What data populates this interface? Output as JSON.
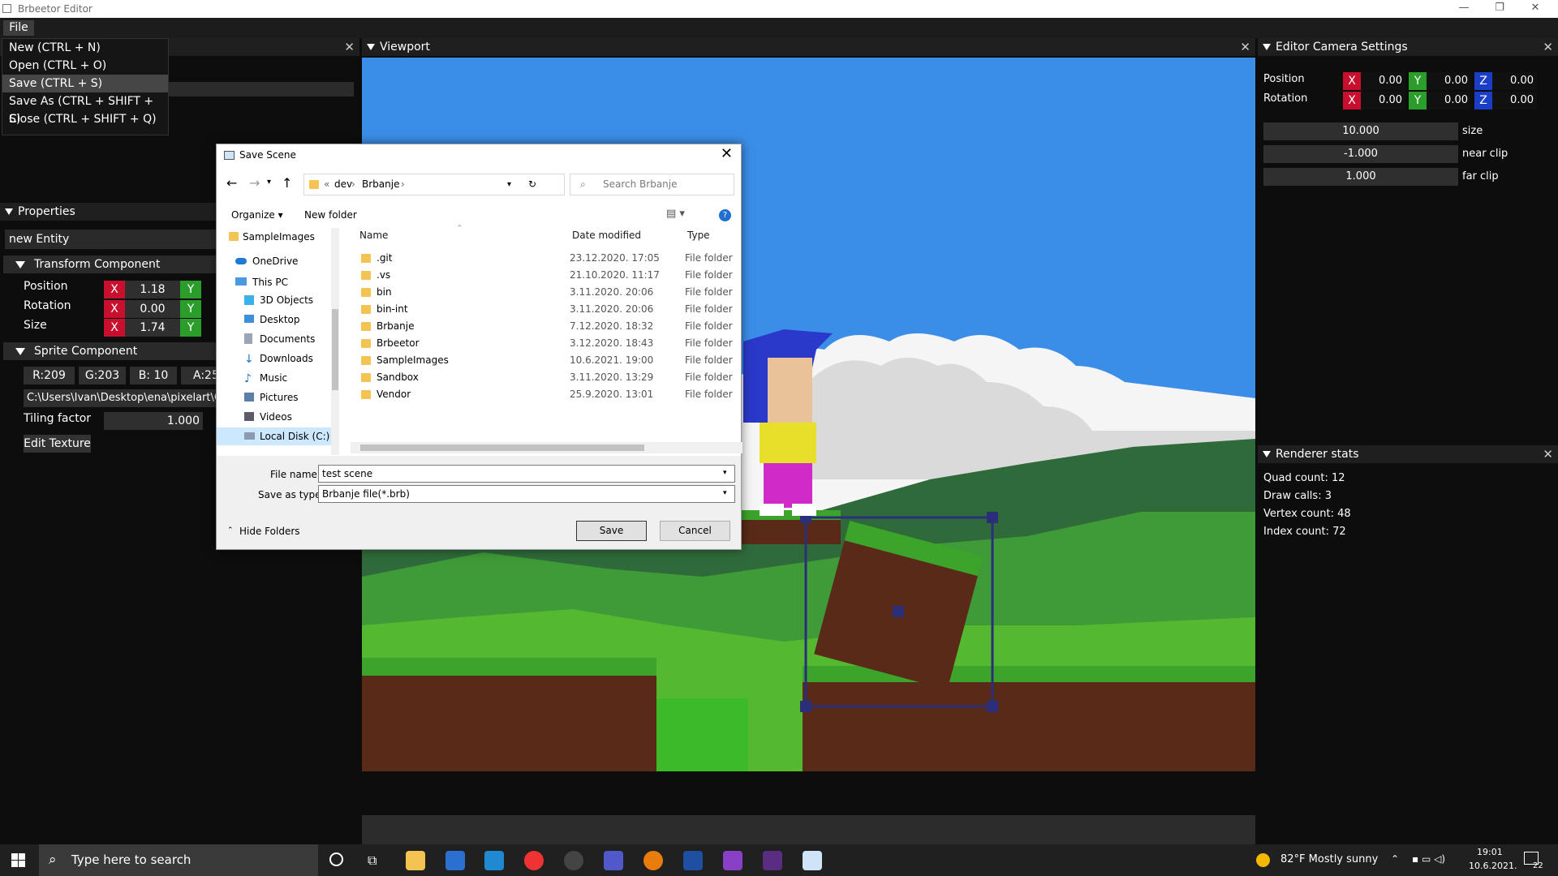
{
  "window": {
    "title": "Brbeetor Editor",
    "min": "—",
    "max": "❐",
    "close": "✕"
  },
  "menu": {
    "file": "File",
    "items": [
      "New (CTRL + N)",
      "Open (CTRL + O)",
      "Save (CTRL + S)",
      "Save As (CTRL + SHIFT + S)",
      "Close (CTRL + SHIFT + Q)"
    ]
  },
  "properties": {
    "title": "Properties",
    "entity_name": "new Entity",
    "transform": {
      "title": "Transform Component",
      "position_label": "Position",
      "rotation_label": "Rotation",
      "size_label": "Size",
      "x": "X",
      "y": "Y",
      "pos_x": "1.18",
      "rot_x": "0.00",
      "size_x": "1.74"
    },
    "sprite": {
      "title": "Sprite Component",
      "r": "R:209",
      "g": "G:203",
      "b": "B: 10",
      "a": "A:25",
      "path": "C:\\Users\\Ivan\\Desktop\\ena\\pixelart\\G",
      "tiling_label": "Tiling factor",
      "tiling_value": "1.000",
      "edit_texture": "Edit Texture"
    }
  },
  "viewport": {
    "title": "Viewport"
  },
  "camera": {
    "title": "Editor Camera Settings",
    "position_label": "Position",
    "rotation_label": "Rotation",
    "x": "X",
    "y": "Y",
    "z": "Z",
    "pos": [
      "0.00",
      "0.00",
      "0.00"
    ],
    "rot": [
      "0.00",
      "0.00",
      "0.00"
    ],
    "size_value": "10.000",
    "size_label": "size",
    "near_value": "-1.000",
    "near_label": "near clip",
    "far_value": "1.000",
    "far_label": "far clip"
  },
  "renderer": {
    "title": "Renderer stats",
    "quad": "Quad count: 12",
    "draw": "Draw calls: 3",
    "vertex": "Vertex count: 48",
    "index": "Index count: 72"
  },
  "dialog": {
    "title": "Save Scene",
    "path": [
      "«",
      "dev",
      "›",
      "Brbanje",
      "›"
    ],
    "search_placeholder": "Search Brbanje",
    "organize": "Organize ▾",
    "new_folder": "New folder",
    "nav": [
      "SampleImages",
      "OneDrive",
      "This PC",
      "3D Objects",
      "Desktop",
      "Documents",
      "Downloads",
      "Music",
      "Pictures",
      "Videos",
      "Local Disk (C:)"
    ],
    "col_name": "Name",
    "col_date": "Date modified",
    "col_type": "Type",
    "files": [
      {
        "name": ".git",
        "date": "23.12.2020. 17:05",
        "type": "File folder"
      },
      {
        "name": ".vs",
        "date": "21.10.2020. 11:17",
        "type": "File folder"
      },
      {
        "name": "bin",
        "date": "3.11.2020. 20:06",
        "type": "File folder"
      },
      {
        "name": "bin-int",
        "date": "3.11.2020. 20:06",
        "type": "File folder"
      },
      {
        "name": "Brbanje",
        "date": "7.12.2020. 18:32",
        "type": "File folder"
      },
      {
        "name": "Brbeetor",
        "date": "3.12.2020. 18:43",
        "type": "File folder"
      },
      {
        "name": "SampleImages",
        "date": "10.6.2021. 19:00",
        "type": "File folder"
      },
      {
        "name": "Sandbox",
        "date": "3.11.2020. 13:29",
        "type": "File folder"
      },
      {
        "name": "Vendor",
        "date": "25.9.2020. 13:01",
        "type": "File folder"
      }
    ],
    "filename_label": "File name:",
    "filename_value": "test scene",
    "type_label": "Save as type:",
    "type_value": "Brbanje file(*.brb)",
    "hide_folders": "Hide Folders",
    "save": "Save",
    "cancel": "Cancel"
  },
  "taskbar": {
    "search_placeholder": "Type here to search",
    "weather": "82°F  Mostly sunny",
    "time": "19:01",
    "date": "10.6.2021.",
    "notif_count": "22"
  }
}
